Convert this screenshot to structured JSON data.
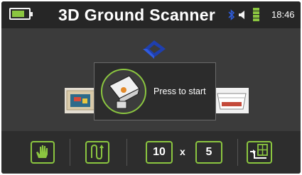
{
  "header": {
    "title": "3D Ground Scanner",
    "time": "18:46"
  },
  "modal": {
    "text": "Press to start"
  },
  "toolbar": {
    "width_value": "10",
    "times_label": "x",
    "length_value": "5"
  },
  "colors": {
    "accent": "#8bc640",
    "logo_blue": "#1f3fae",
    "background": "#3b3b3b",
    "header": "#262626"
  },
  "icons": [
    "battery-icon",
    "bluetooth-icon",
    "speaker-icon",
    "battery-level-icon",
    "scan-arrow-logo",
    "hand-icon",
    "scan-path-icon",
    "grid-corner-icon"
  ]
}
